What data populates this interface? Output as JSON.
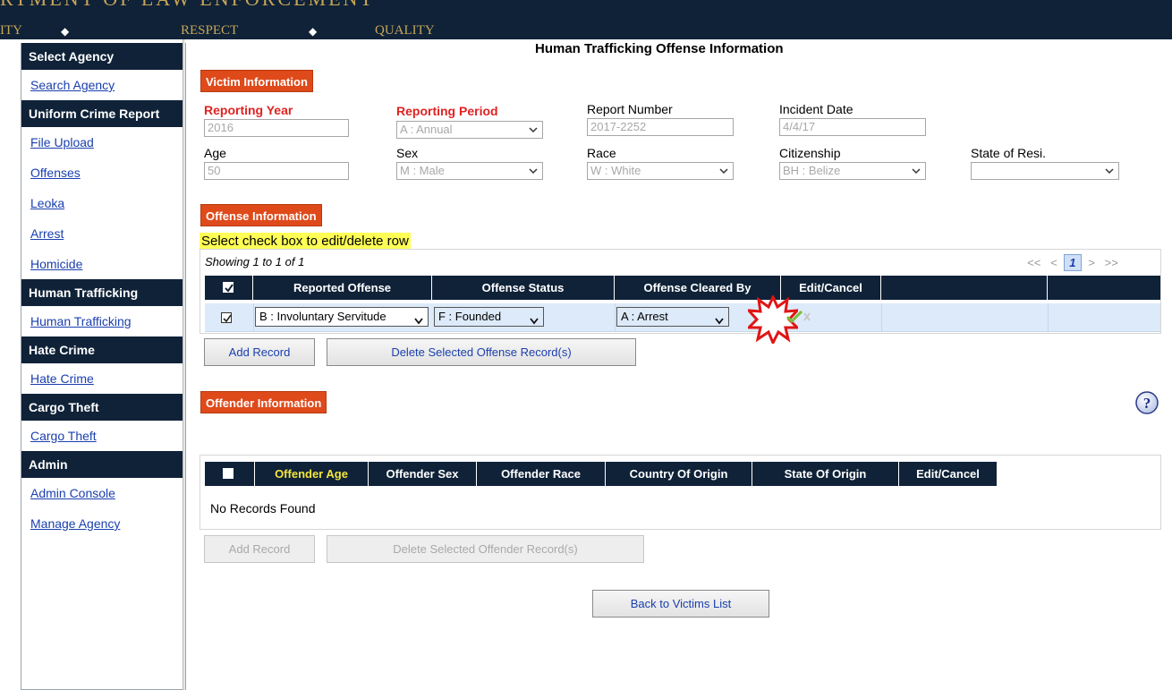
{
  "banner": {
    "top_text": "RTMENT OF LAW ENFORCEMENT",
    "mottos": [
      "ITY",
      "RESPECT",
      "QUALITY"
    ]
  },
  "sidebar": {
    "sections": [
      {
        "title": "Select Agency",
        "links": [
          "Search Agency"
        ]
      },
      {
        "title": "Uniform Crime Report",
        "links": [
          "File Upload",
          "Offenses",
          "Leoka",
          "Arrest",
          "Homicide"
        ]
      },
      {
        "title": "Human Trafficking",
        "links": [
          "Human Trafficking"
        ]
      },
      {
        "title": "Hate Crime",
        "links": [
          "Hate Crime"
        ]
      },
      {
        "title": "Cargo Theft",
        "links": [
          "Cargo Theft"
        ]
      },
      {
        "title": "Admin",
        "links": [
          "Admin Console",
          "Manage Agency"
        ]
      }
    ]
  },
  "page_title": "Human Trafficking Offense Information",
  "victim": {
    "tag": "Victim Information",
    "reporting_year": {
      "label": "Reporting Year",
      "value": "2016"
    },
    "reporting_period": {
      "label": "Reporting Period",
      "value": "A : Annual"
    },
    "report_number": {
      "label": "Report Number",
      "value": "2017-2252"
    },
    "incident_date": {
      "label": "Incident Date",
      "value": "4/4/17"
    },
    "age": {
      "label": "Age",
      "value": "50"
    },
    "sex": {
      "label": "Sex",
      "value": "M : Male"
    },
    "race": {
      "label": "Race",
      "value": "W : White"
    },
    "citizenship": {
      "label": "Citizenship",
      "value": "BH : Belize"
    },
    "state_of_residence": {
      "label": "State of Resi.",
      "value": ""
    }
  },
  "offense": {
    "tag": "Offense Information",
    "hint": "Select check box to edit/delete row",
    "showing": "Showing 1 to 1 of 1",
    "pager": {
      "first": "<<",
      "prev": "<",
      "current": "1",
      "next": ">",
      "last": ">>"
    },
    "columns": [
      "Reported Offense",
      "Offense Status",
      "Offense Cleared By",
      "Edit/Cancel"
    ],
    "row": {
      "checked": true,
      "reported_offense": "B : Involuntary Servitude",
      "offense_status": "F : Founded",
      "offense_cleared_by": "A : Arrest"
    },
    "add_label": "Add Record",
    "delete_label": "Delete Selected Offense Record(s)"
  },
  "offender": {
    "tag": "Offender Information",
    "columns": [
      "Offender Age",
      "Offender Sex",
      "Offender Race",
      "Country Of Origin",
      "State Of Origin",
      "Edit/Cancel"
    ],
    "no_records": "No Records Found",
    "add_label": "Add Record",
    "delete_label": "Delete Selected Offender Record(s)"
  },
  "back_label": "Back to Victims List",
  "colors": {
    "navy": "#0f2238",
    "orange": "#df4a1b",
    "required_red": "#e02222",
    "link_blue": "#1a3fae",
    "highlight_yellow": "#ffff55"
  }
}
